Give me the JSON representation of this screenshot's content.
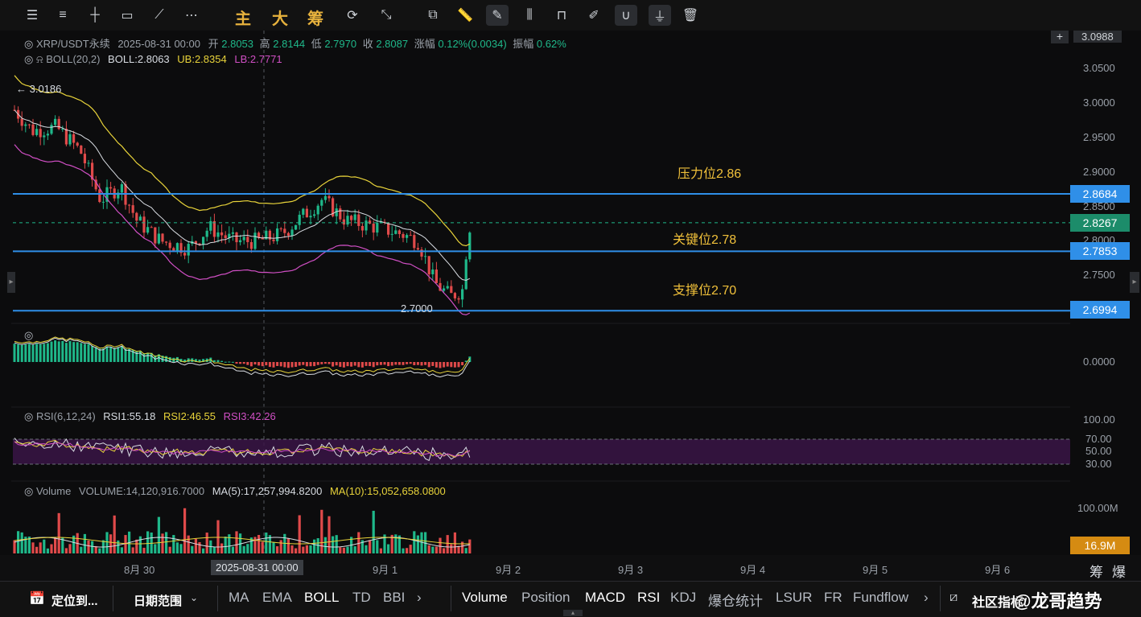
{
  "toolbar": {
    "cn1": "主",
    "cn2": "大",
    "cn3": "筹"
  },
  "legend": {
    "symbol": "XRP/USDT永续",
    "datetime": "2025-08-31 00:00",
    "open_label": "开",
    "open": "2.8053",
    "high_label": "高",
    "high": "2.8144",
    "low_label": "低",
    "low": "2.7970",
    "close_label": "收",
    "close": "2.8087",
    "chg_label": "涨幅",
    "chg": "0.12%(0.0034)",
    "amp_label": "振幅",
    "amp": "0.62%"
  },
  "boll": {
    "name": "BOLL(20,2)",
    "boll": "BOLL:2.8063",
    "ub": "UB:2.8354",
    "lb": "LB:2.7771"
  },
  "rsi": {
    "name": "RSI(6,12,24)",
    "r1": "RSI1:55.18",
    "r2": "RSI2:46.55",
    "r3": "RSI3:42.26"
  },
  "volume": {
    "name": "Volume",
    "vol": "VOLUME:14,120,916.7000",
    "ma5": "MA(5):17,257,994.8200",
    "ma10": "MA(10):15,052,658.0800"
  },
  "markers": {
    "high": "← 3.0186",
    "low": "2.7000"
  },
  "annotations": {
    "resistance": "压力位2.86",
    "key": "关键位2.78",
    "support": "支撑位2.70"
  },
  "price_axis": {
    "top_label": "3.0988",
    "ticks": [
      "3.0500",
      "3.0000",
      "2.9500",
      "2.9000",
      "2.8500",
      "2.8000",
      "2.7500"
    ],
    "lines": {
      "resistance": "2.8684",
      "current": "2.8267",
      "key": "2.7853",
      "support": "2.6994"
    }
  },
  "macd_axis": {
    "zero": "0.0000"
  },
  "rsi_axis": [
    "100.00",
    "70.00",
    "50.00",
    "30.00"
  ],
  "vol_axis": {
    "top": "100.00M",
    "current": "16.9M"
  },
  "x_axis": {
    "ticks": [
      "8月 30",
      "9月 1",
      "9月 2",
      "9月 3",
      "9月 4",
      "9月 5",
      "9月 6"
    ],
    "crosshair": "2025-08-31 00:00"
  },
  "corner": {
    "a": "筹",
    "b": "爆"
  },
  "bottom_bar": {
    "locate": "定位到...",
    "range": "日期范围",
    "left_tabs": [
      "MA",
      "EMA",
      "BOLL",
      "TD",
      "BBI"
    ],
    "right_tabs": [
      "Volume",
      "Position",
      "MACD",
      "RSI",
      "KDJ",
      "爆仓统计",
      "LSUR",
      "FR",
      "Fundflow"
    ],
    "community": "社区指标",
    "watermark": "@龙哥趋势"
  },
  "colors": {
    "up": "#1fb88a",
    "down": "#e04a4a",
    "line_blue": "#2f8fe8",
    "ub": "#e8d33a",
    "lb": "#d04fc4"
  }
}
